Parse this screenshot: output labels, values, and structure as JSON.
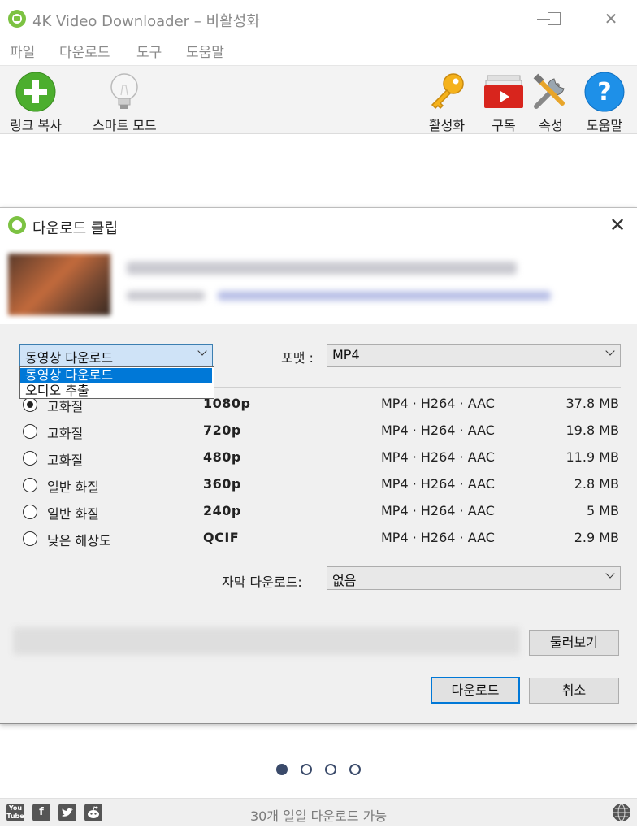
{
  "app": {
    "title": "4K Video Downloader – 비활성화",
    "window_controls": {
      "minimize": "minimize-icon",
      "maximize": "maximize-icon",
      "close": "✕"
    }
  },
  "menu": [
    "파일",
    "다운로드",
    "도구",
    "도움말"
  ],
  "toolbar": {
    "left": [
      {
        "label": "링크 복사",
        "icon": "plus-icon"
      },
      {
        "label": "스마트 모드",
        "icon": "lightbulb-icon"
      }
    ],
    "right": [
      {
        "label": "활성화",
        "icon": "key-icon"
      },
      {
        "label": "구독",
        "icon": "subscribe-icon"
      },
      {
        "label": "속성",
        "icon": "tools-icon"
      },
      {
        "label": "도움말",
        "icon": "help-icon"
      }
    ]
  },
  "dialog": {
    "title": "다운로드 클립",
    "close": "✕",
    "mode": {
      "selected": "동영상 다운로드",
      "options": [
        "동영상 다운로드",
        "오디오 추출"
      ]
    },
    "format_label": "포맷 :",
    "format_value": "MP4",
    "rows": [
      {
        "quality": "고화질",
        "resolution": "1080p",
        "codec": "MP4 · H264 · AAC",
        "size": "37.8 MB",
        "selected": true
      },
      {
        "quality": "고화질",
        "resolution": "720p",
        "codec": "MP4 · H264 · AAC",
        "size": "19.8 MB",
        "selected": false
      },
      {
        "quality": "고화질",
        "resolution": "480p",
        "codec": "MP4 · H264 · AAC",
        "size": "11.9 MB",
        "selected": false
      },
      {
        "quality": "일반 화질",
        "resolution": "360p",
        "codec": "MP4 · H264 · AAC",
        "size": "2.8 MB",
        "selected": false
      },
      {
        "quality": "일반 화질",
        "resolution": "240p",
        "codec": "MP4 · H264 · AAC",
        "size": "5 MB",
        "selected": false
      },
      {
        "quality": "낮은 해상도",
        "resolution": "QCIF",
        "codec": "MP4 · H264 · AAC",
        "size": "2.9 MB",
        "selected": false
      }
    ],
    "subtitle_label": "자막 다운로드:",
    "subtitle_value": "없음",
    "browse_button": "둘러보기",
    "download_button": "다운로드",
    "cancel_button": "취소"
  },
  "pager": {
    "count": 4,
    "active": 0
  },
  "status": {
    "text": "30개 일일 다운로드 가능",
    "social": [
      "YouTube",
      "f",
      "twitter",
      "reddit"
    ]
  },
  "colors": {
    "accent": "#0078d7",
    "logo_green": "#7cc242",
    "dialog_bg": "#f0f0f0"
  }
}
